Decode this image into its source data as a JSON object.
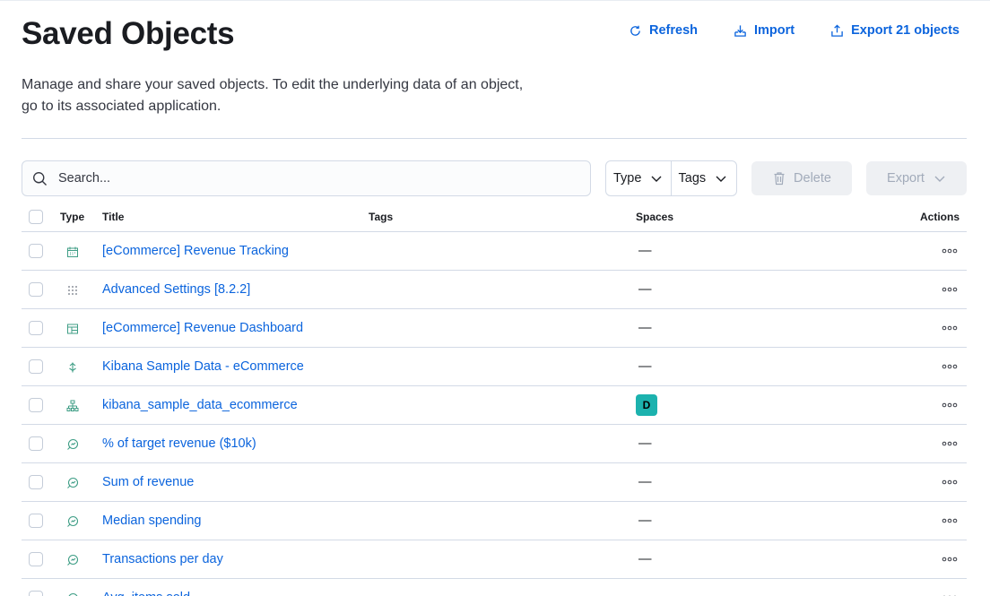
{
  "header": {
    "title": "Saved Objects",
    "refresh_label": "Refresh",
    "import_label": "Import",
    "export_label": "Export 21 objects",
    "description": "Manage and share your saved objects. To edit the underlying data of an object, go to its associated application."
  },
  "toolbar": {
    "search_placeholder": "Search...",
    "type_filter_label": "Type",
    "tags_filter_label": "Tags",
    "delete_label": "Delete",
    "export_label": "Export"
  },
  "table": {
    "columns": {
      "type": "Type",
      "title": "Title",
      "tags": "Tags",
      "spaces": "Spaces",
      "actions": "Actions"
    },
    "rows": [
      {
        "icon": "calendar-icon",
        "title": "[eCommerce] Revenue Tracking",
        "spaces": "—"
      },
      {
        "icon": "advanced-settings-icon",
        "title": "Advanced Settings [8.2.2]",
        "spaces": "—"
      },
      {
        "icon": "dashboard-icon",
        "title": "[eCommerce] Revenue Dashboard",
        "spaces": "—"
      },
      {
        "icon": "canvas-icon",
        "title": "Kibana Sample Data - eCommerce",
        "spaces": "—"
      },
      {
        "icon": "index-pattern-icon",
        "title": "kibana_sample_data_ecommerce",
        "spaces": "D"
      },
      {
        "icon": "lens-icon",
        "title": "% of target revenue ($10k)",
        "spaces": "—"
      },
      {
        "icon": "lens-icon",
        "title": "Sum of revenue",
        "spaces": "—"
      },
      {
        "icon": "lens-icon",
        "title": "Median spending",
        "spaces": "—"
      },
      {
        "icon": "lens-icon",
        "title": "Transactions per day",
        "spaces": "—"
      },
      {
        "icon": "lens-icon",
        "title": "Avg. items sold",
        "spaces": "—"
      }
    ]
  },
  "colors": {
    "link": "#0b64dd",
    "space_badge": "#1cb2ae",
    "border": "#d3dae6",
    "disabled_bg": "#eef0f3",
    "disabled_text": "#a2abba"
  }
}
